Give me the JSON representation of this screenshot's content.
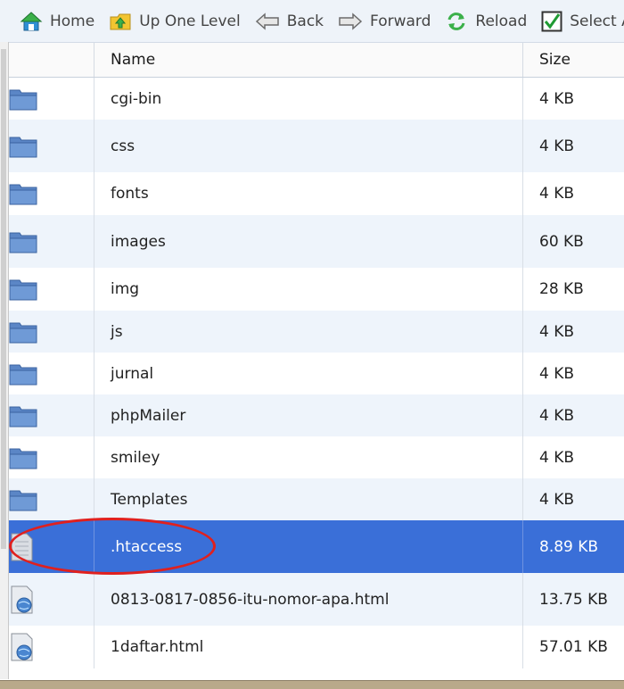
{
  "toolbar": {
    "home": "Home",
    "up": "Up One Level",
    "back": "Back",
    "forward": "Forward",
    "reload": "Reload",
    "select_all": "Select Al"
  },
  "columns": {
    "name": "Name",
    "size": "Size"
  },
  "files": [
    {
      "name": "cgi-bin",
      "size": "4 KB",
      "type": "folder",
      "height": 47
    },
    {
      "name": "css",
      "size": "4 KB",
      "type": "folder",
      "height": 59
    },
    {
      "name": "fonts",
      "size": "4 KB",
      "type": "folder",
      "height": 48
    },
    {
      "name": "images",
      "size": "60 KB",
      "type": "folder",
      "height": 59
    },
    {
      "name": "img",
      "size": "28 KB",
      "type": "folder",
      "height": 48
    },
    {
      "name": "js",
      "size": "4 KB",
      "type": "folder",
      "height": 47
    },
    {
      "name": "jurnal",
      "size": "4 KB",
      "type": "folder",
      "height": 47
    },
    {
      "name": "phpMailer",
      "size": "4 KB",
      "type": "folder",
      "height": 47
    },
    {
      "name": "smiley",
      "size": "4 KB",
      "type": "folder",
      "height": 47
    },
    {
      "name": "Templates",
      "size": "4 KB",
      "type": "folder",
      "height": 47
    },
    {
      "name": ".htaccess",
      "size": "8.89 KB",
      "type": "text-file",
      "selected": true,
      "height": 59
    },
    {
      "name": "0813-0817-0856-itu-nomor-apa.html",
      "size": "13.75 KB",
      "type": "html-file",
      "height": 59
    },
    {
      "name": "1daftar.html",
      "size": "57.01 KB",
      "type": "html-file",
      "height": 48
    }
  ],
  "icons": {
    "home": "home-icon",
    "up": "up-folder-icon",
    "back": "back-arrow-icon",
    "forward": "forward-arrow-icon",
    "reload": "reload-icon",
    "select_all": "checkbox-icon",
    "folder": "folder-icon",
    "text_file": "text-file-icon",
    "html_file": "html-file-icon"
  },
  "colors": {
    "selected_row": "#3a6fd8",
    "alt_row": "#eef4fb",
    "highlight": "#e0201e",
    "toolbar_bg": "#eef3f9"
  }
}
